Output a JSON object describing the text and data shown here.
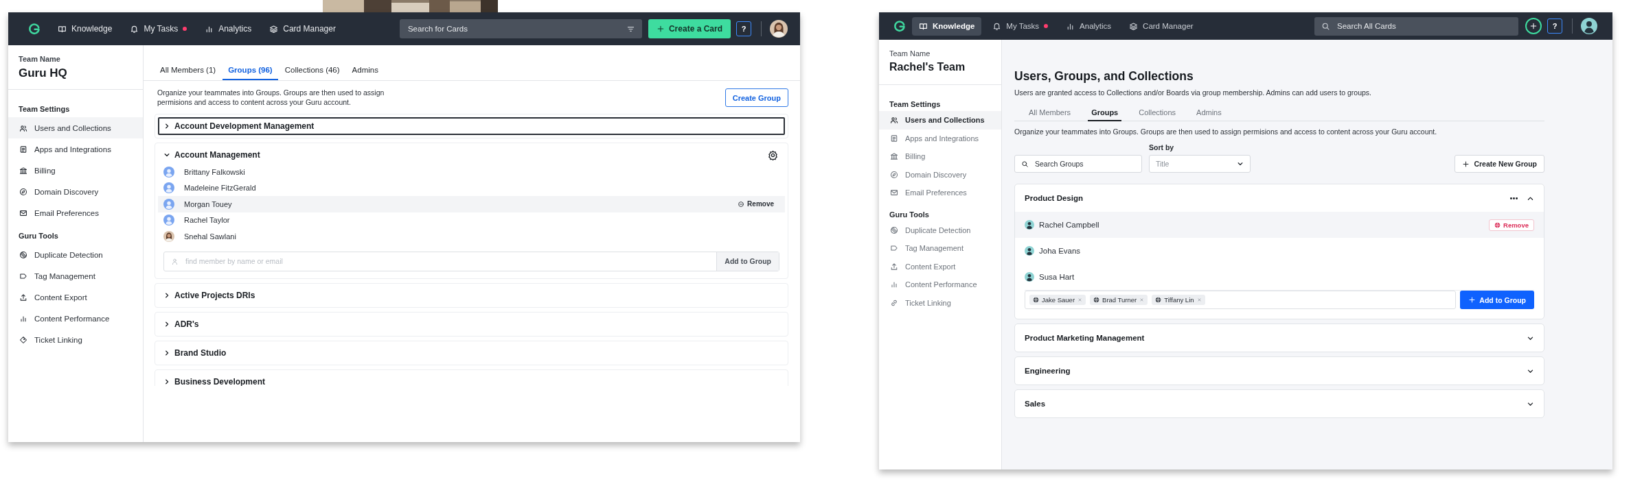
{
  "left_window": {
    "top_bar": {
      "nav": [
        {
          "label": "Knowledge",
          "selected": false,
          "alert": false
        },
        {
          "label": "My Tasks",
          "selected": false,
          "alert": true
        },
        {
          "label": "Analytics",
          "selected": false,
          "alert": false
        },
        {
          "label": "Card Manager",
          "selected": false,
          "alert": false
        }
      ],
      "search": {
        "placeholder": "Search for Cards",
        "kind": "filter"
      },
      "create": {
        "kind": "labeled",
        "label": "Create a Card"
      },
      "help": "?"
    },
    "sidebar": {
      "team_label": "Team Name",
      "team_name": "Guru HQ",
      "sections": [
        {
          "title": "Team Settings",
          "items": [
            {
              "label": "Users and Collections",
              "selected": true
            },
            {
              "label": "Apps and Integrations",
              "selected": false
            },
            {
              "label": "Billing",
              "selected": false
            },
            {
              "label": "Domain Discovery",
              "selected": false
            },
            {
              "label": "Email Preferences",
              "selected": false
            }
          ]
        },
        {
          "title": "Guru Tools",
          "items": [
            {
              "label": "Duplicate Detection",
              "selected": false
            },
            {
              "label": "Tag Management",
              "selected": false
            },
            {
              "label": "Content Export",
              "selected": false
            },
            {
              "label": "Content Performance",
              "selected": false
            },
            {
              "label": "Ticket Linking",
              "selected": false
            }
          ]
        }
      ]
    },
    "tabs": [
      {
        "label": "All Members (1)",
        "selected": false
      },
      {
        "label": "Groups (96)",
        "selected": true
      },
      {
        "label": "Collections (46)",
        "selected": false
      },
      {
        "label": "Admins",
        "selected": false
      }
    ],
    "description": "Organize your teammates into Groups. Groups are then used to assign permisions and access to content across your Guru account.",
    "create_group_button": "Create Group",
    "groups": [
      {
        "name": "Account Development Management",
        "expanded": false,
        "focused": true
      },
      {
        "name": "Account Management",
        "expanded": true,
        "focused": false,
        "members": [
          {
            "name": "Brittany Falkowski",
            "kind": "default",
            "selected": false
          },
          {
            "name": "Madeleine FitzGerald",
            "kind": "default",
            "selected": false
          },
          {
            "name": "Morgan Touey",
            "kind": "default",
            "selected": true,
            "action": "Remove"
          },
          {
            "name": "Rachel Taylor",
            "kind": "default",
            "selected": false
          },
          {
            "name": "Snehal Sawlani",
            "selected": false
          }
        ],
        "add_member": {
          "placeholder": "find member by name or email",
          "button": "Add to Group"
        }
      },
      {
        "name": "Active Projects DRIs",
        "expanded": false,
        "focused": false
      },
      {
        "name": "ADR's",
        "expanded": false,
        "focused": false
      },
      {
        "name": "Brand Studio",
        "expanded": false,
        "focused": false
      },
      {
        "name": "Business Development",
        "expanded": false,
        "focused": false
      }
    ]
  },
  "right_window": {
    "top_bar": {
      "nav": [
        {
          "label": "Knowledge",
          "selected": true,
          "alert": false
        },
        {
          "label": "My Tasks",
          "selected": false,
          "alert": true
        },
        {
          "label": "Analytics",
          "selected": false,
          "alert": false
        },
        {
          "label": "Card Manager",
          "selected": false,
          "alert": false
        }
      ],
      "search": {
        "placeholder": "Search All Cards",
        "kind": "search"
      },
      "create": {
        "kind": "icon"
      },
      "help": "?"
    },
    "sidebar": {
      "team_label": "Team Name",
      "team_name": "Rachel's Team",
      "sections": [
        {
          "title": "Team Settings",
          "items": [
            {
              "label": "Users and Collections",
              "selected": true
            },
            {
              "label": "Apps and Integrations",
              "selected": false
            },
            {
              "label": "Billing",
              "selected": false
            },
            {
              "label": "Domain Discovery",
              "selected": false
            },
            {
              "label": "Email Preferences",
              "selected": false
            }
          ]
        },
        {
          "title": "Guru Tools",
          "items": [
            {
              "label": "Duplicate Detection",
              "selected": false
            },
            {
              "label": "Tag Management",
              "selected": false
            },
            {
              "label": "Content Export",
              "selected": false
            },
            {
              "label": "Content Performance",
              "selected": false
            },
            {
              "label": "Ticket Linking",
              "selected": false
            }
          ]
        }
      ]
    },
    "heading": "Users, Groups, and Collections",
    "subtitle": "Users are granted access to Collections and/or Boards via group membership. Admins can add users to groups.",
    "tabs": [
      {
        "label": "All Members",
        "selected": false
      },
      {
        "label": "Groups",
        "selected": true
      },
      {
        "label": "Collections",
        "selected": false
      },
      {
        "label": "Admins",
        "selected": false
      }
    ],
    "description": "Organize your teammates into Groups. Groups are then used to assign permisions and access to content across your Guru account.",
    "search": {
      "placeholder": "Search Groups"
    },
    "sort": {
      "label": "Sort by",
      "value": "Title"
    },
    "create_group_button": "Create New Group",
    "groups": [
      {
        "name": "Product Design",
        "expanded": true,
        "members": [
          {
            "name": "Rachel Campbell",
            "selected": true,
            "action": "Remove"
          },
          {
            "name": "Joha Evans",
            "selected": false
          },
          {
            "name": "Susa Hart",
            "selected": false
          }
        ],
        "add_member": {
          "tags": [
            "Jake Sauer",
            "Brad Turner",
            "Tiffany Lin"
          ],
          "button": "Add to Group"
        }
      },
      {
        "name": "Product Marketing Management",
        "expanded": false
      },
      {
        "name": "Engineering",
        "expanded": false
      },
      {
        "name": "Sales",
        "expanded": false
      }
    ]
  }
}
